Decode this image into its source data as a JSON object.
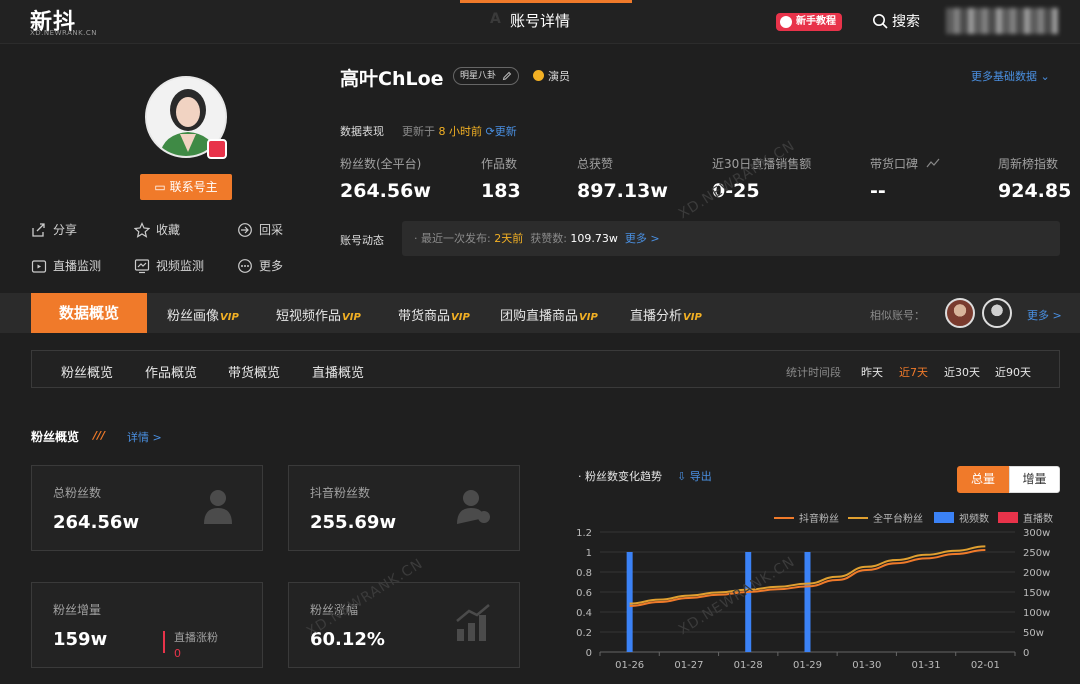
{
  "header": {
    "logo": "新抖",
    "logo_sub": "XD.NEWRANK.CN",
    "ghost": "A          T",
    "title": "账号详情",
    "tutorial": "新手教程",
    "search": "搜索"
  },
  "profile": {
    "contact": "联系号主",
    "actions": [
      "分享",
      "收藏",
      "回采",
      "直播监测",
      "视频监测",
      "更多"
    ],
    "name": "高叶ChLoe",
    "tag": "明星八卦",
    "verify": "演员",
    "more_basic": "更多基础数据",
    "perf_title": "数据表现",
    "updated_prefix": "更新于",
    "updated_time": "8 小时前",
    "refresh": "更新",
    "stats": [
      {
        "label": "粉丝数(全平台)",
        "value": "264.56w"
      },
      {
        "label": "作品数",
        "value": "183"
      },
      {
        "label": "总获赞",
        "value": "897.13w"
      },
      {
        "label": "近30日直播销售额",
        "value": "0-25"
      },
      {
        "label": "带货口碑",
        "value": "--"
      },
      {
        "label": "周新榜指数",
        "value": "924.85"
      }
    ],
    "dyn_label": "账号动态",
    "dyn_prefix": "· 最近一次发布:",
    "dyn_time": "2天前",
    "dyn_likes_label": "获赞数:",
    "dyn_likes": "109.73w",
    "dyn_more": "更多 >"
  },
  "tabs": {
    "active": "数据概览",
    "items": [
      "粉丝画像",
      "短视频作品",
      "带货商品",
      "团购直播商品",
      "直播分析"
    ],
    "vip": "VIP",
    "similar": "相似账号：",
    "more": "更多 >"
  },
  "subtabs": {
    "items": [
      "粉丝概览",
      "作品概览",
      "带货概览",
      "直播概览"
    ],
    "period_label": "统计时间段",
    "periods": [
      "昨天",
      "近7天",
      "近30天",
      "近90天"
    ],
    "active_period": "近7天"
  },
  "fans": {
    "title": "粉丝概览",
    "detail": "详情 >",
    "cards": [
      {
        "label": "总粉丝数",
        "value": "264.56w"
      },
      {
        "label": "抖音粉丝数",
        "value": "255.69w"
      },
      {
        "label": "粉丝增量",
        "value": "159w"
      },
      {
        "label": "粉丝涨幅",
        "value": "60.12%"
      }
    ],
    "live_growth_label": "直播涨粉",
    "live_growth_value": "0"
  },
  "chart_panel": {
    "title": "粉丝数变化趋势",
    "export": "导出",
    "seg_on": "总量",
    "seg_off": "增量"
  },
  "chart_data": {
    "type": "line",
    "title": "粉丝数变化趋势",
    "categories": [
      "01-26",
      "01-27",
      "01-28",
      "01-29",
      "01-30",
      "01-31",
      "02-01"
    ],
    "x": [
      "01-26",
      "01-26.5",
      "01-27",
      "01-27.5",
      "01-28",
      "01-28.5",
      "01-29",
      "01-29.5",
      "01-30",
      "01-30.5",
      "01-31",
      "01-31.5",
      "02-01"
    ],
    "series": [
      {
        "name": "抖音粉丝",
        "axis": "right",
        "color": "#f07a2a",
        "values": [
          115,
          125,
          135,
          143,
          150,
          157,
          164,
          180,
          205,
          222,
          234,
          245,
          255
        ]
      },
      {
        "name": "全平台粉丝",
        "axis": "right",
        "color": "#e0a030",
        "values": [
          121,
          131,
          141,
          149,
          156,
          163,
          171,
          188,
          213,
          230,
          243,
          253,
          264
        ]
      },
      {
        "name": "视频数",
        "axis": "left",
        "type": "bar",
        "color": "#3b82f6",
        "points": {
          "01-26": 1,
          "01-28": 1,
          "01-29": 1
        }
      },
      {
        "name": "直播数",
        "axis": "left",
        "type": "bar",
        "color": "#e8334a",
        "points": {}
      }
    ],
    "y_left": {
      "ticks": [
        "0",
        "0.2",
        "0.4",
        "0.6",
        "0.8",
        "1",
        "1.2"
      ],
      "range": [
        0,
        1.2
      ]
    },
    "y_right": {
      "ticks": [
        "0",
        "50w",
        "100w",
        "150w",
        "200w",
        "250w",
        "300w"
      ],
      "range": [
        0,
        300
      ]
    },
    "grid": true,
    "legend": "top-right"
  },
  "watermark": "XD.NEWRANK.CN"
}
